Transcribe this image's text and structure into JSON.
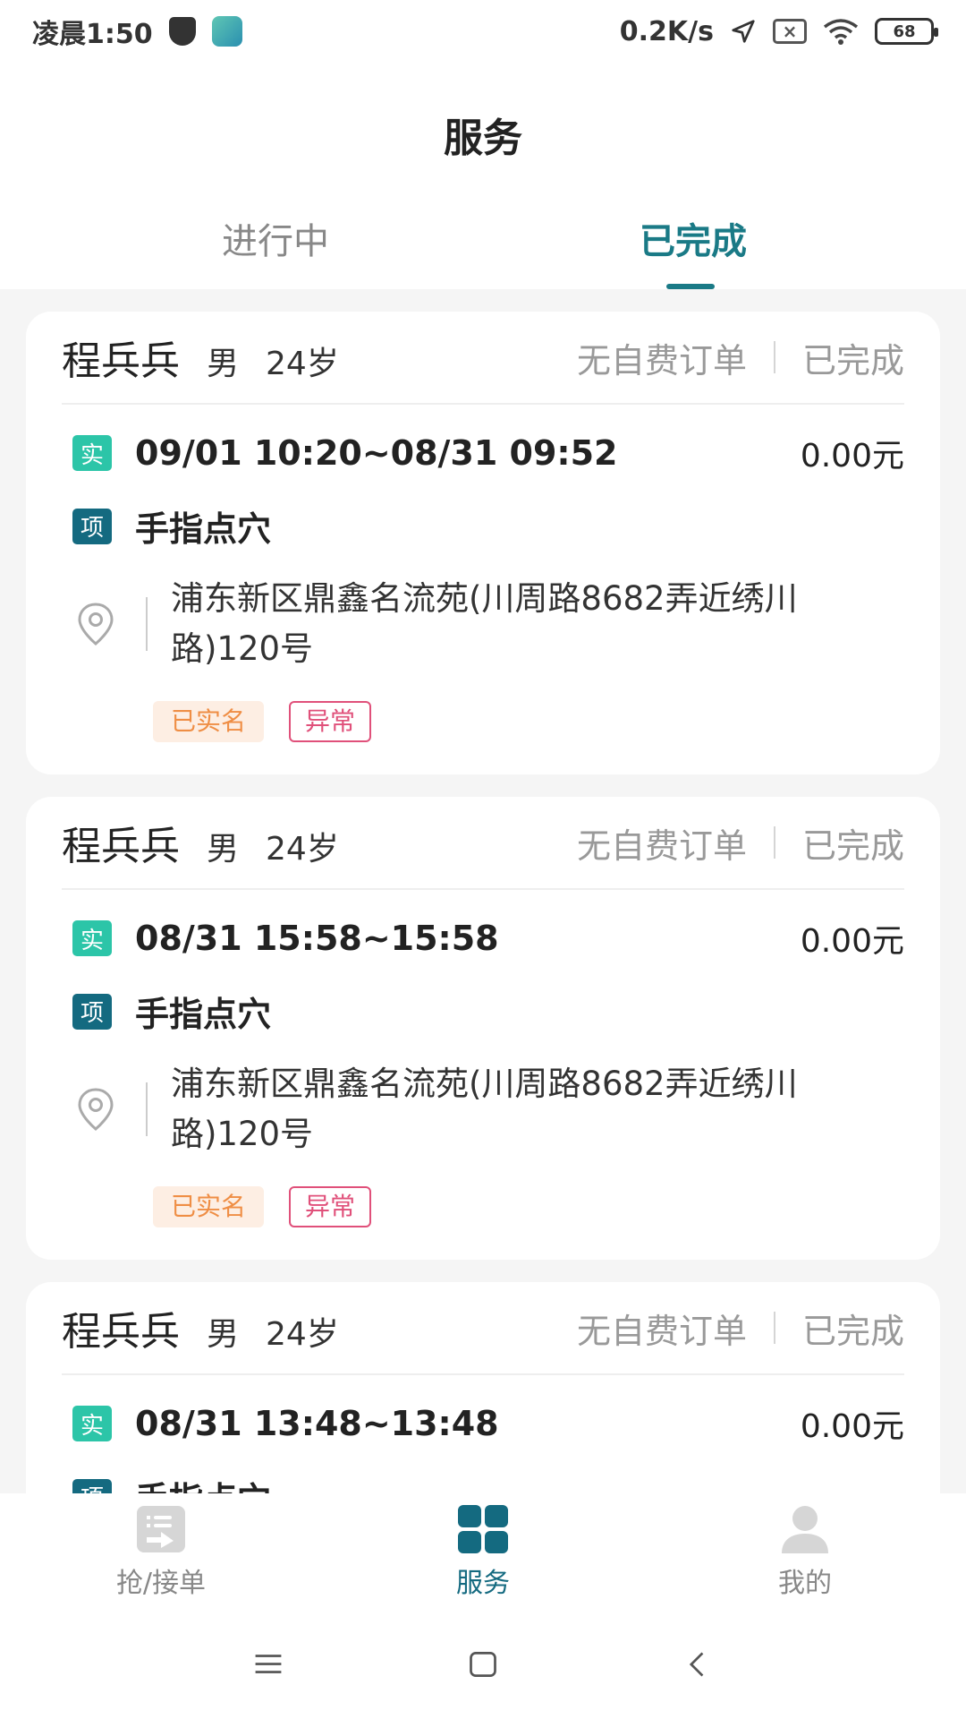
{
  "status_bar": {
    "time": "凌晨1:50",
    "net_speed": "0.2K/s",
    "battery": "68"
  },
  "header": {
    "title": "服务"
  },
  "tabs": [
    {
      "label": "进行中",
      "active": false
    },
    {
      "label": "已完成",
      "active": true
    }
  ],
  "cards": [
    {
      "name": "程兵兵",
      "gender": "男",
      "age": "24岁",
      "order_type": "无自费订单",
      "status": "已完成",
      "time_tag": "实",
      "time": "09/01 10:20~08/31 09:52",
      "price": "0.00元",
      "item_tag": "项",
      "item": "手指点穴",
      "address": "浦东新区鼎鑫名流苑(川周路8682弄近绣川路)120号",
      "badge_verified": "已实名",
      "badge_abnormal": "异常"
    },
    {
      "name": "程兵兵",
      "gender": "男",
      "age": "24岁",
      "order_type": "无自费订单",
      "status": "已完成",
      "time_tag": "实",
      "time": "08/31 15:58~15:58",
      "price": "0.00元",
      "item_tag": "项",
      "item": "手指点穴",
      "address": "浦东新区鼎鑫名流苑(川周路8682弄近绣川路)120号",
      "badge_verified": "已实名",
      "badge_abnormal": "异常"
    },
    {
      "name": "程兵兵",
      "gender": "男",
      "age": "24岁",
      "order_type": "无自费订单",
      "status": "已完成",
      "time_tag": "实",
      "time": "08/31 13:48~13:48",
      "price": "0.00元",
      "item_tag": "项",
      "item": "手指点穴"
    }
  ],
  "bottom_nav": [
    {
      "label": "抢/接单",
      "icon": "order-icon",
      "active": false
    },
    {
      "label": "服务",
      "icon": "grid-icon",
      "active": true
    },
    {
      "label": "我的",
      "icon": "profile-icon",
      "active": false
    }
  ],
  "colors": {
    "accent": "#1a7a86",
    "shi_tag": "#2cc5a8",
    "xiang_tag": "#146a80",
    "abnormal": "#e0507a",
    "verified": "#ef8e45"
  }
}
